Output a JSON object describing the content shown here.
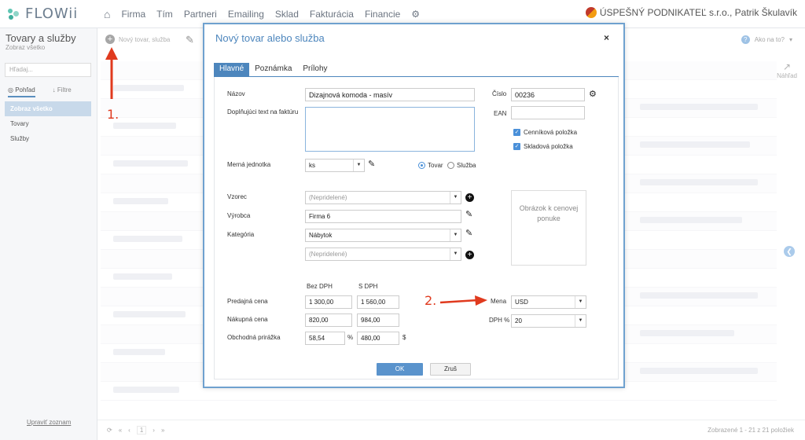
{
  "app": {
    "logo_text": "FLOWii"
  },
  "nav": {
    "items": [
      "Firma",
      "Tím",
      "Partneri",
      "Emailing",
      "Sklad",
      "Fakturácia",
      "Financie"
    ]
  },
  "company": {
    "name": "ÚSPEŠNÝ PODNIKATEĽ s.r.o., Patrik Škulavík"
  },
  "sidebar": {
    "title": "Tovary a služby",
    "subtitle": "Zobraz všetko",
    "search_placeholder": "Hľadaj...",
    "tab_view": "Pohľad",
    "tab_filters": "Filtre",
    "items": [
      "Zobraz všetko",
      "Tovary",
      "Služby"
    ],
    "footer_link": "Upraviť zoznam"
  },
  "toolbar": {
    "new_label": "Nový tovar, služba"
  },
  "help": {
    "label": "Ako na to?"
  },
  "preview": {
    "label": "Náhľad"
  },
  "footer": {
    "page": "1",
    "shown": "Zobrazené 1 - 21 z 21 položiek"
  },
  "modal": {
    "title": "Nový tovar alebo služba",
    "close": "×",
    "tabs": [
      "Hlavné",
      "Poznámka",
      "Prílohy"
    ],
    "fields": {
      "name_label": "Názov",
      "name_value": "Dizajnová komoda - masív",
      "number_label": "Číslo",
      "number_value": "00236",
      "ean_label": "EAN",
      "ean_value": "",
      "extra_text_label": "Doplňujúci text na faktúru",
      "price_list_item": "Cenníková položka",
      "stock_item": "Skladová položka",
      "unit_label": "Merná jednotka",
      "unit_value": "ks",
      "type_goods": "Tovar",
      "type_service": "Služba",
      "template_label": "Vzorec",
      "template_value": "(Nepridelené)",
      "manufacturer_label": "Výrobca",
      "manufacturer_value": "Firma 6",
      "category_label": "Kategória",
      "category_value": "Nábytok",
      "category2_value": "(Nepridelené)",
      "image_box": "Obrázok k cenovej ponuke",
      "col_without_vat": "Bez DPH",
      "col_with_vat": "S DPH",
      "sale_price_label": "Predajná cena",
      "sale_price_net": "1 300,00",
      "sale_price_gross": "1 560,00",
      "purchase_price_label": "Nákupná cena",
      "purchase_price_net": "820,00",
      "purchase_price_gross": "984,00",
      "margin_label": "Obchodná prirážka",
      "margin_percent": "58,54",
      "percent_sign": "%",
      "margin_amount": "480,00",
      "currency_sign": "$",
      "currency_label": "Mena",
      "currency_value": "USD",
      "vat_label": "DPH %",
      "vat_value": "20"
    },
    "ok": "OK",
    "cancel": "Zruš"
  },
  "annotations": {
    "step1": "1.",
    "step2": "2."
  }
}
